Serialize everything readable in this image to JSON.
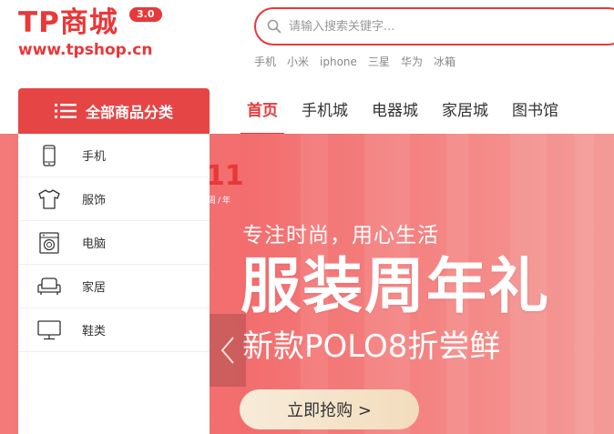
{
  "logo": {
    "title": "TP商城",
    "version": "3.0",
    "url": "www.tpshop.cn"
  },
  "search": {
    "placeholder": "请输入搜索关键字..."
  },
  "hot_words": [
    "手机",
    "小米",
    "iphone",
    "三星",
    "华为",
    "冰箱"
  ],
  "category_button": {
    "label": "全部商品分类",
    "icon": "menu-icon"
  },
  "nav": {
    "items": [
      {
        "label": "首页",
        "active": true
      },
      {
        "label": "手机城",
        "active": false
      },
      {
        "label": "电器城",
        "active": false
      },
      {
        "label": "家居城",
        "active": false
      },
      {
        "label": "图书馆",
        "active": false
      }
    ]
  },
  "categories": [
    {
      "label": "手机",
      "icon": "phone-icon"
    },
    {
      "label": "服饰",
      "icon": "tshirt-icon"
    },
    {
      "label": "电脑",
      "icon": "washing-machine-icon"
    },
    {
      "label": "家居",
      "icon": "sofa-icon"
    },
    {
      "label": "鞋类",
      "icon": "monitor-icon"
    }
  ],
  "banner": {
    "anniversary": "11",
    "anniversary_sub": "周/年",
    "slogan": "专注时尚，用心生活",
    "headline": "服装周年礼",
    "subhead": "新款POLO8折尝鲜",
    "button": "立即抢购 >"
  },
  "colors": {
    "accent": "#e8383a",
    "banner": "#f37a78"
  }
}
